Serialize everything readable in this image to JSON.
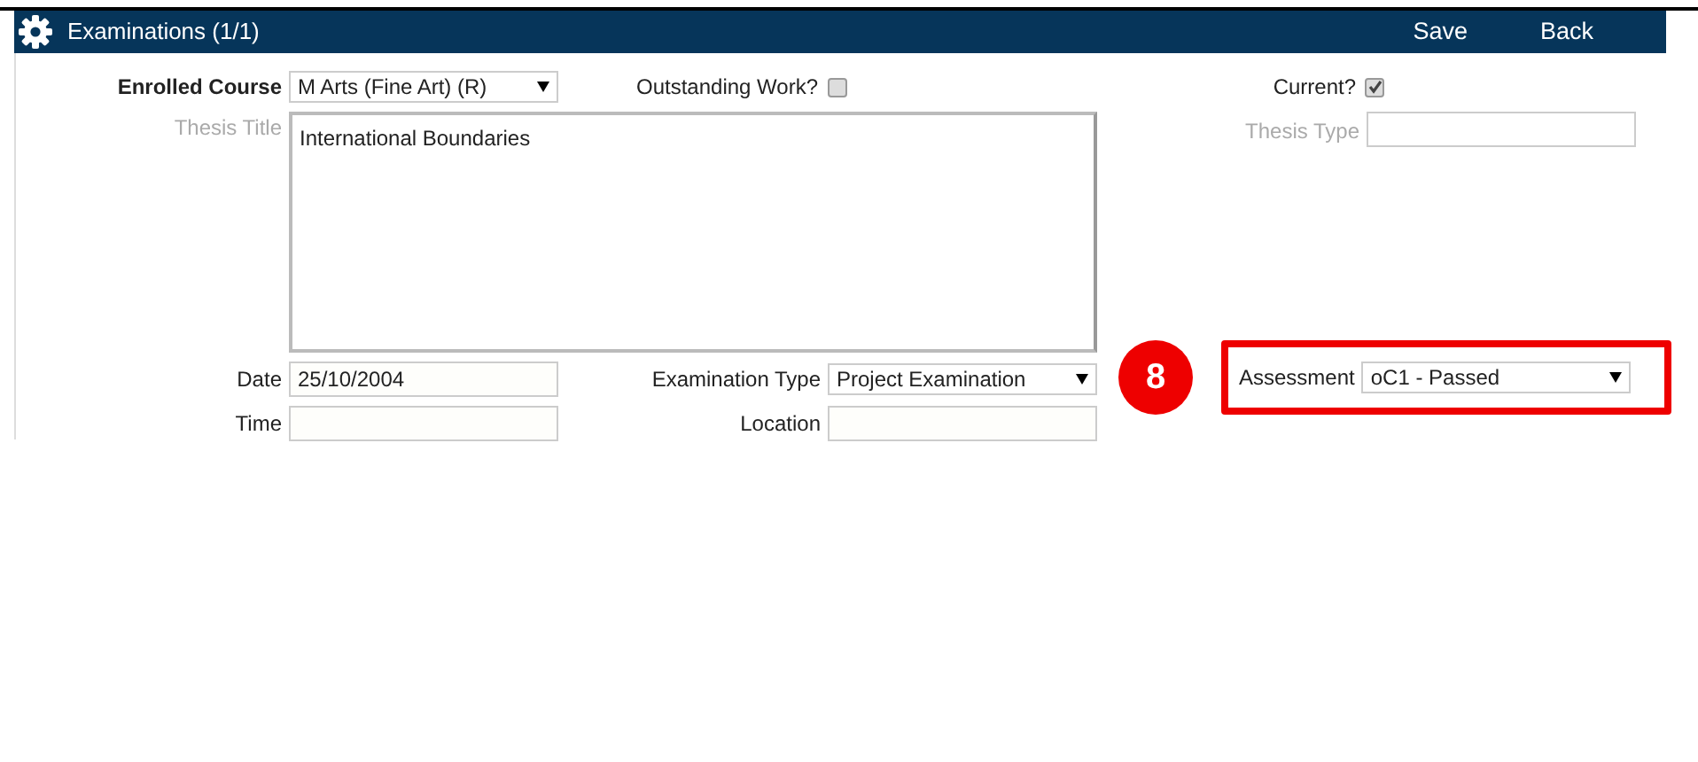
{
  "panel": {
    "title": "Examinations (1/1)",
    "actions": [
      "Save",
      "Back"
    ]
  },
  "enrolled_course": {
    "label": "Enrolled Course",
    "value": "M Arts (Fine Art) (R)",
    "required": true,
    "disabled": false
  },
  "outstanding_work": {
    "label": "Outstanding Work?",
    "checked": false
  },
  "current": {
    "label": "Current?",
    "checked": true
  },
  "thesis_title": {
    "label": "Thesis Title",
    "value": "International Boundaries",
    "required": false,
    "disabled": true
  },
  "thesis_type": {
    "label": "Thesis Type",
    "required": false,
    "disabled": true
  },
  "date": {
    "label": "Date",
    "value": "25/10/2004",
    "required": false,
    "disabled": false
  },
  "examination_type": {
    "label": "Examination Type",
    "value": "Project Examination",
    "required": false,
    "disabled": false
  },
  "callout": {
    "number": "8"
  },
  "assessment": {
    "label": "Assessment",
    "value": "oC1 - Passed",
    "required": false,
    "disabled": false
  },
  "time": {
    "label": "Time",
    "required": false,
    "disabled": false
  },
  "location": {
    "label": "Location",
    "required": false,
    "disabled": false
  }
}
